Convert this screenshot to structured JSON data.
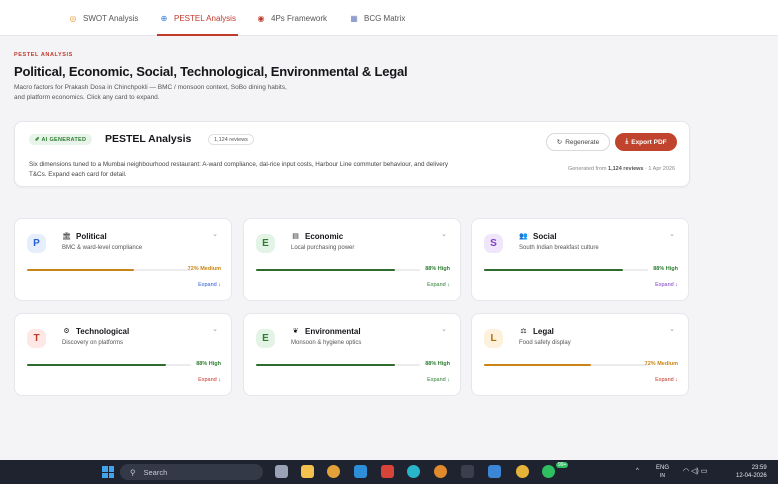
{
  "tabs": [
    {
      "icon": "target-icon",
      "glyph": "◎",
      "label": "SWOT Analysis",
      "active": false,
      "color": "#e59a2e"
    },
    {
      "icon": "globe-icon",
      "glyph": "⊕",
      "label": "PESTEL Analysis",
      "active": true,
      "color": "#2b7bd1"
    },
    {
      "icon": "dartboard-icon",
      "glyph": "◉",
      "label": "4Ps Framework",
      "active": false,
      "color": "#c0392b"
    },
    {
      "icon": "chart-icon",
      "glyph": "▦",
      "label": "BCG Matrix",
      "active": false,
      "color": "#6b7fbf"
    }
  ],
  "header": {
    "eyebrow": "PESTEL ANALYSIS",
    "title": "Political, Economic, Social, Technological, Environmental & Legal",
    "desc_line1": "Macro factors for Prakash Dosa in Chinchpokli — BMC / monsoon context, SoBo dining habits,",
    "desc_line2": "and platform economics. Click any card to expand."
  },
  "ai_panel": {
    "badge": "✐ AI GENERATED",
    "title": "PESTEL Analysis",
    "reviews": "1,124 reviews",
    "desc_line1": "Six dimensions tuned to a Mumbai neighbourhood restaurant: A-ward compliance, dal-rice input costs, Harbour Line commuter behaviour, and delivery",
    "desc_line2": "T&Cs. Expand each card for detail.",
    "regen_label": "Regenerate",
    "export_label": "Export PDF",
    "gen_prefix": "Generated from",
    "gen_reviews": "1,124 reviews",
    "gen_date": "· 1 Apr 2026"
  },
  "cards": [
    {
      "letter": "P",
      "letter_bg": "#e6eefc",
      "letter_color": "#2b5fd1",
      "icon": "building-icon",
      "glyph": "🏛",
      "title": "Political",
      "subtitle": "BMC & ward-level compliance",
      "score": "72% Medium",
      "pct": 0.65,
      "bar_color": "#c98516",
      "score_color": "#c98516",
      "expand": "Expand ↓",
      "expand_color": "#2b5fd1"
    },
    {
      "letter": "E",
      "letter_bg": "#e3f4e6",
      "letter_color": "#2e7d32",
      "icon": "ledger-icon",
      "glyph": "▤",
      "title": "Economic",
      "subtitle": "Local purchasing power",
      "score": "88% High",
      "pct": 0.85,
      "bar_color": "#2e6b2f",
      "score_color": "#2e7d32",
      "expand": "Expand ↓",
      "expand_color": "#2e7d32"
    },
    {
      "letter": "S",
      "letter_bg": "#efe6fb",
      "letter_color": "#7b3fc4",
      "icon": "people-icon",
      "glyph": "👥",
      "title": "Social",
      "subtitle": "South Indian breakfast culture",
      "score": "88% High",
      "pct": 0.85,
      "bar_color": "#2e6b2f",
      "score_color": "#2e7d32",
      "expand": "Expand ↓",
      "expand_color": "#7b3fc4"
    },
    {
      "letter": "T",
      "letter_bg": "#fde8e6",
      "letter_color": "#c0392b",
      "icon": "cog-icon",
      "glyph": "⚙",
      "title": "Technological",
      "subtitle": "Discovery on platforms",
      "score": "88% High",
      "pct": 0.85,
      "bar_color": "#2e6b2f",
      "score_color": "#2e7d32",
      "expand": "Expand ↓",
      "expand_color": "#c0392b"
    },
    {
      "letter": "E",
      "letter_bg": "#e3f4e6",
      "letter_color": "#2e7d32",
      "icon": "leaf-icon",
      "glyph": "❦",
      "title": "Environmental",
      "subtitle": "Monsoon & hygiene optics",
      "score": "88% High",
      "pct": 0.85,
      "bar_color": "#2e6b2f",
      "score_color": "#2e7d32",
      "expand": "Expand ↓",
      "expand_color": "#2e7d32"
    },
    {
      "letter": "L",
      "letter_bg": "#fdf1dc",
      "letter_color": "#b06d10",
      "icon": "scales-icon",
      "glyph": "⚖",
      "title": "Legal",
      "subtitle": "Food safety display",
      "score": "72% Medium",
      "pct": 0.65,
      "bar_color": "#c98516",
      "score_color": "#c98516",
      "expand": "Expand ↓",
      "expand_color": "#c0392b"
    }
  ],
  "taskbar": {
    "search_placeholder": "Search",
    "lang": "ENG",
    "region": "IN",
    "time": "23:59",
    "date": "12-04-2026",
    "badge": "99+"
  }
}
